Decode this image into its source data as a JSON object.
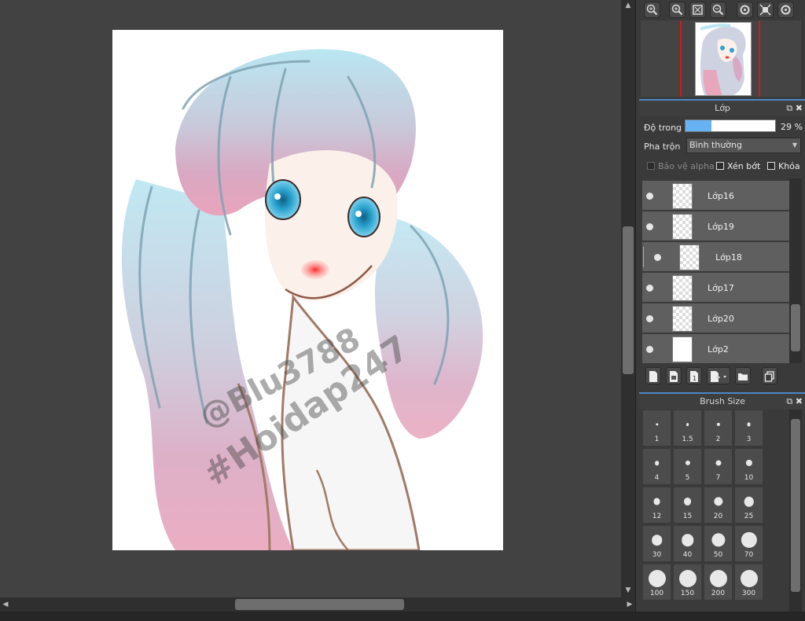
{
  "artwork": {
    "watermark_line1": "@Blu3788",
    "watermark_line2": "#Hoidap247"
  },
  "navigator": {
    "toolbar_icons": [
      "zoom-in-icon",
      "zoom-out-icon",
      "fit-window-icon",
      "zoom-minus-icon",
      "rotate-left-icon",
      "actual-size-icon",
      "rotate-right-icon"
    ]
  },
  "layer_panel": {
    "title": "Lớp",
    "opacity_label": "Độ trong",
    "opacity_value": "29 %",
    "opacity_percent": 29,
    "blend_label": "Pha trộn",
    "blend_value": "Bình thường",
    "protect_alpha_label": "Bảo vệ alpha",
    "clipping_label": "Xén bớt",
    "lock_label": "Khóa",
    "layers": [
      {
        "name": "Lớp16",
        "thumb": "transparent"
      },
      {
        "name": "Lớp19",
        "thumb": "transparent"
      },
      {
        "name": "Lớp18",
        "thumb": "transparent",
        "clipped": true
      },
      {
        "name": "Lớp17",
        "thumb": "transparent"
      },
      {
        "name": "Lớp20",
        "thumb": "transparent"
      },
      {
        "name": "Lớp2",
        "thumb": "white"
      }
    ],
    "toolbar_icons": [
      "new-layer-icon",
      "new-raster-layer-icon",
      "new-layer-1bit-icon",
      "add-layer-menu-icon",
      "folder-icon",
      "duplicate-layer-icon"
    ]
  },
  "brush_panel": {
    "title": "Brush Size",
    "sizes": [
      "1",
      "1.5",
      "2",
      "3",
      "4",
      "5",
      "7",
      "10",
      "12",
      "15",
      "20",
      "25",
      "30",
      "40",
      "50",
      "70",
      "100",
      "150",
      "200",
      "300"
    ]
  },
  "colors": {
    "accent": "#4d88c4",
    "opacity_fill": "#67b2f2",
    "panel_bg": "#3a3a3a",
    "canvas_bg": "#424242"
  }
}
